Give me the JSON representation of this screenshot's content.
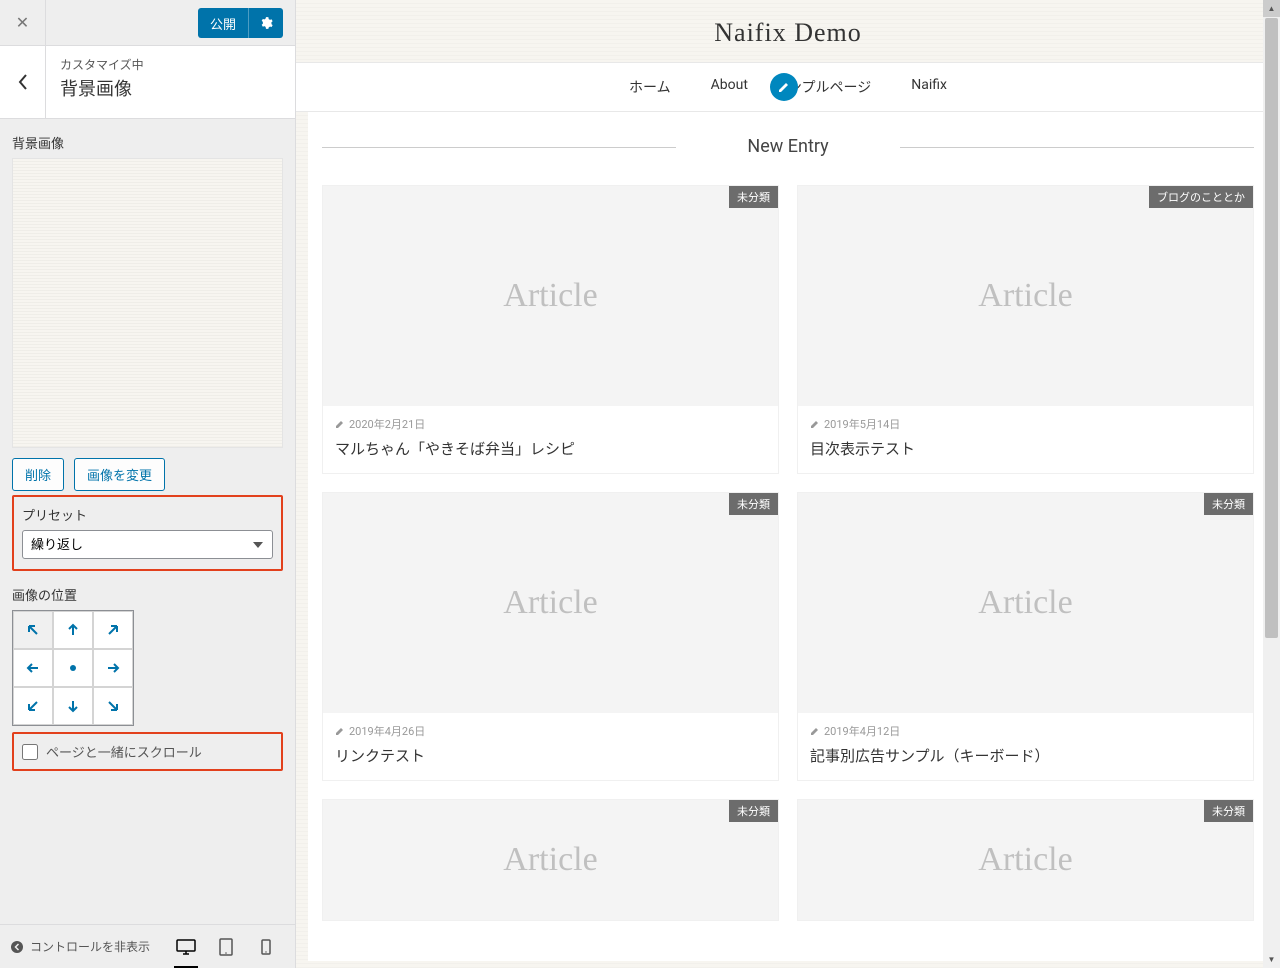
{
  "topbar": {
    "publish_label": "公開",
    "close_icon": "✕"
  },
  "header": {
    "customizing_label": "カスタマイズ中",
    "section_title": "背景画像"
  },
  "panel": {
    "bg_image_label": "背景画像",
    "delete_label": "削除",
    "change_label": "画像を変更",
    "preset_label": "プリセット",
    "preset_value": "繰り返し",
    "position_label": "画像の位置",
    "scroll_label": "ページと一緒にスクロール",
    "scroll_checked": false
  },
  "bottombar": {
    "hide_controls_label": "コントロールを非表示"
  },
  "preview": {
    "site_title": "Naifix Demo",
    "nav_items": [
      "ホーム",
      "About",
      "ンプルページ",
      "Naifix"
    ],
    "section_heading": "New Entry",
    "cards": [
      {
        "tag": "未分類",
        "date": "2020年2月21日",
        "title": "マルちゃん「やきそば弁当」レシピ",
        "thumb": "Article"
      },
      {
        "tag": "ブログのこととか",
        "date": "2019年5月14日",
        "title": "目次表示テスト",
        "thumb": "Article"
      },
      {
        "tag": "未分類",
        "date": "2019年4月26日",
        "title": "リンクテスト",
        "thumb": "Article"
      },
      {
        "tag": "未分類",
        "date": "2019年4月12日",
        "title": "記事別広告サンプル（キーボード）",
        "thumb": "Article"
      },
      {
        "tag": "未分類",
        "date": "",
        "title": "",
        "thumb": "Article",
        "short": true
      },
      {
        "tag": "未分類",
        "date": "",
        "title": "",
        "thumb": "Article",
        "short": true
      }
    ]
  }
}
